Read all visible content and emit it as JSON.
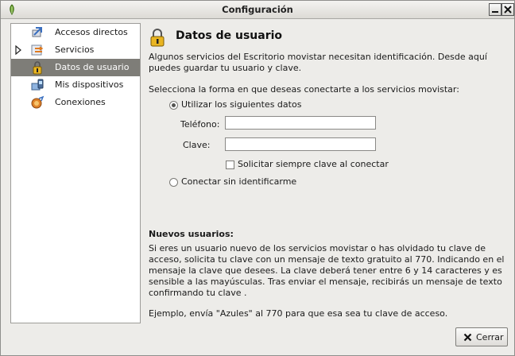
{
  "window": {
    "title": "Configuración"
  },
  "sidebar": {
    "items": [
      {
        "label": "Accesos directos",
        "icon": "shortcuts-icon",
        "selected": false
      },
      {
        "label": "Servicios",
        "icon": "services-icon",
        "selected": false,
        "expandable": true
      },
      {
        "label": "Datos de usuario",
        "icon": "user-data-icon",
        "selected": true
      },
      {
        "label": "Mis dispositivos",
        "icon": "devices-icon",
        "selected": false
      },
      {
        "label": "Conexiones",
        "icon": "connections-icon",
        "selected": false
      }
    ]
  },
  "main": {
    "title": "Datos de usuario",
    "intro": "Algunos servicios del Escritorio movistar necesitan identificación. Desde aquí puedes guardar tu usuario y clave.",
    "prompt": "Selecciona la forma en que deseas conectarte a los servicios movistar:",
    "option_use_data": "Utilizar los siguientes datos",
    "option_use_data_checked": true,
    "phone_label": "Teléfono:",
    "phone_value": "",
    "password_label": "Clave:",
    "password_value": "",
    "always_ask_label": "Solicitar siempre clave al conectar",
    "always_ask_checked": false,
    "option_no_id": "Conectar sin identificarme",
    "option_no_id_checked": false,
    "new_users_title": "Nuevos usuarios:",
    "new_users_body": "Si eres un usuario nuevo de los servicios movistar o has olvidado tu clave de acceso, solicita tu clave con un mensaje de texto gratuito al 770. Indicando en el mensaje la clave que desees. La clave deberá tener entre 6 y 14 caracteres y es sensible a las mayúsculas. Tras enviar el mensaje, recibirás un mensaje de texto confirmando tu clave .",
    "example": "Ejemplo, envía \"Azules\" al 770 para que esa sea tu clave de acceso."
  },
  "footer": {
    "close_label": "Cerrar"
  },
  "colors": {
    "selection": "#7e7d78",
    "window_bg": "#edece9"
  }
}
